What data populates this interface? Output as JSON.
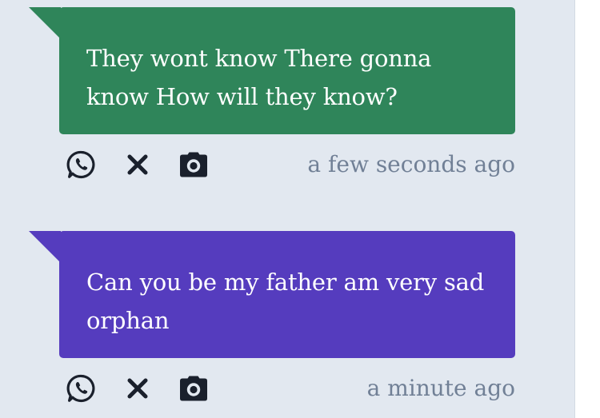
{
  "feed": {
    "messages": [
      {
        "text": "They wont know There gonna know How will they know?",
        "timestamp": "a few seconds ago",
        "color": "#2f855a"
      },
      {
        "text": "Can you be my father am very sad orphan",
        "timestamp": "a minute ago",
        "color": "#553cbe"
      }
    ],
    "actions": {
      "share_icon": "whatsapp-icon",
      "dismiss_icon": "close-icon",
      "snapshot_icon": "camera-icon"
    }
  }
}
